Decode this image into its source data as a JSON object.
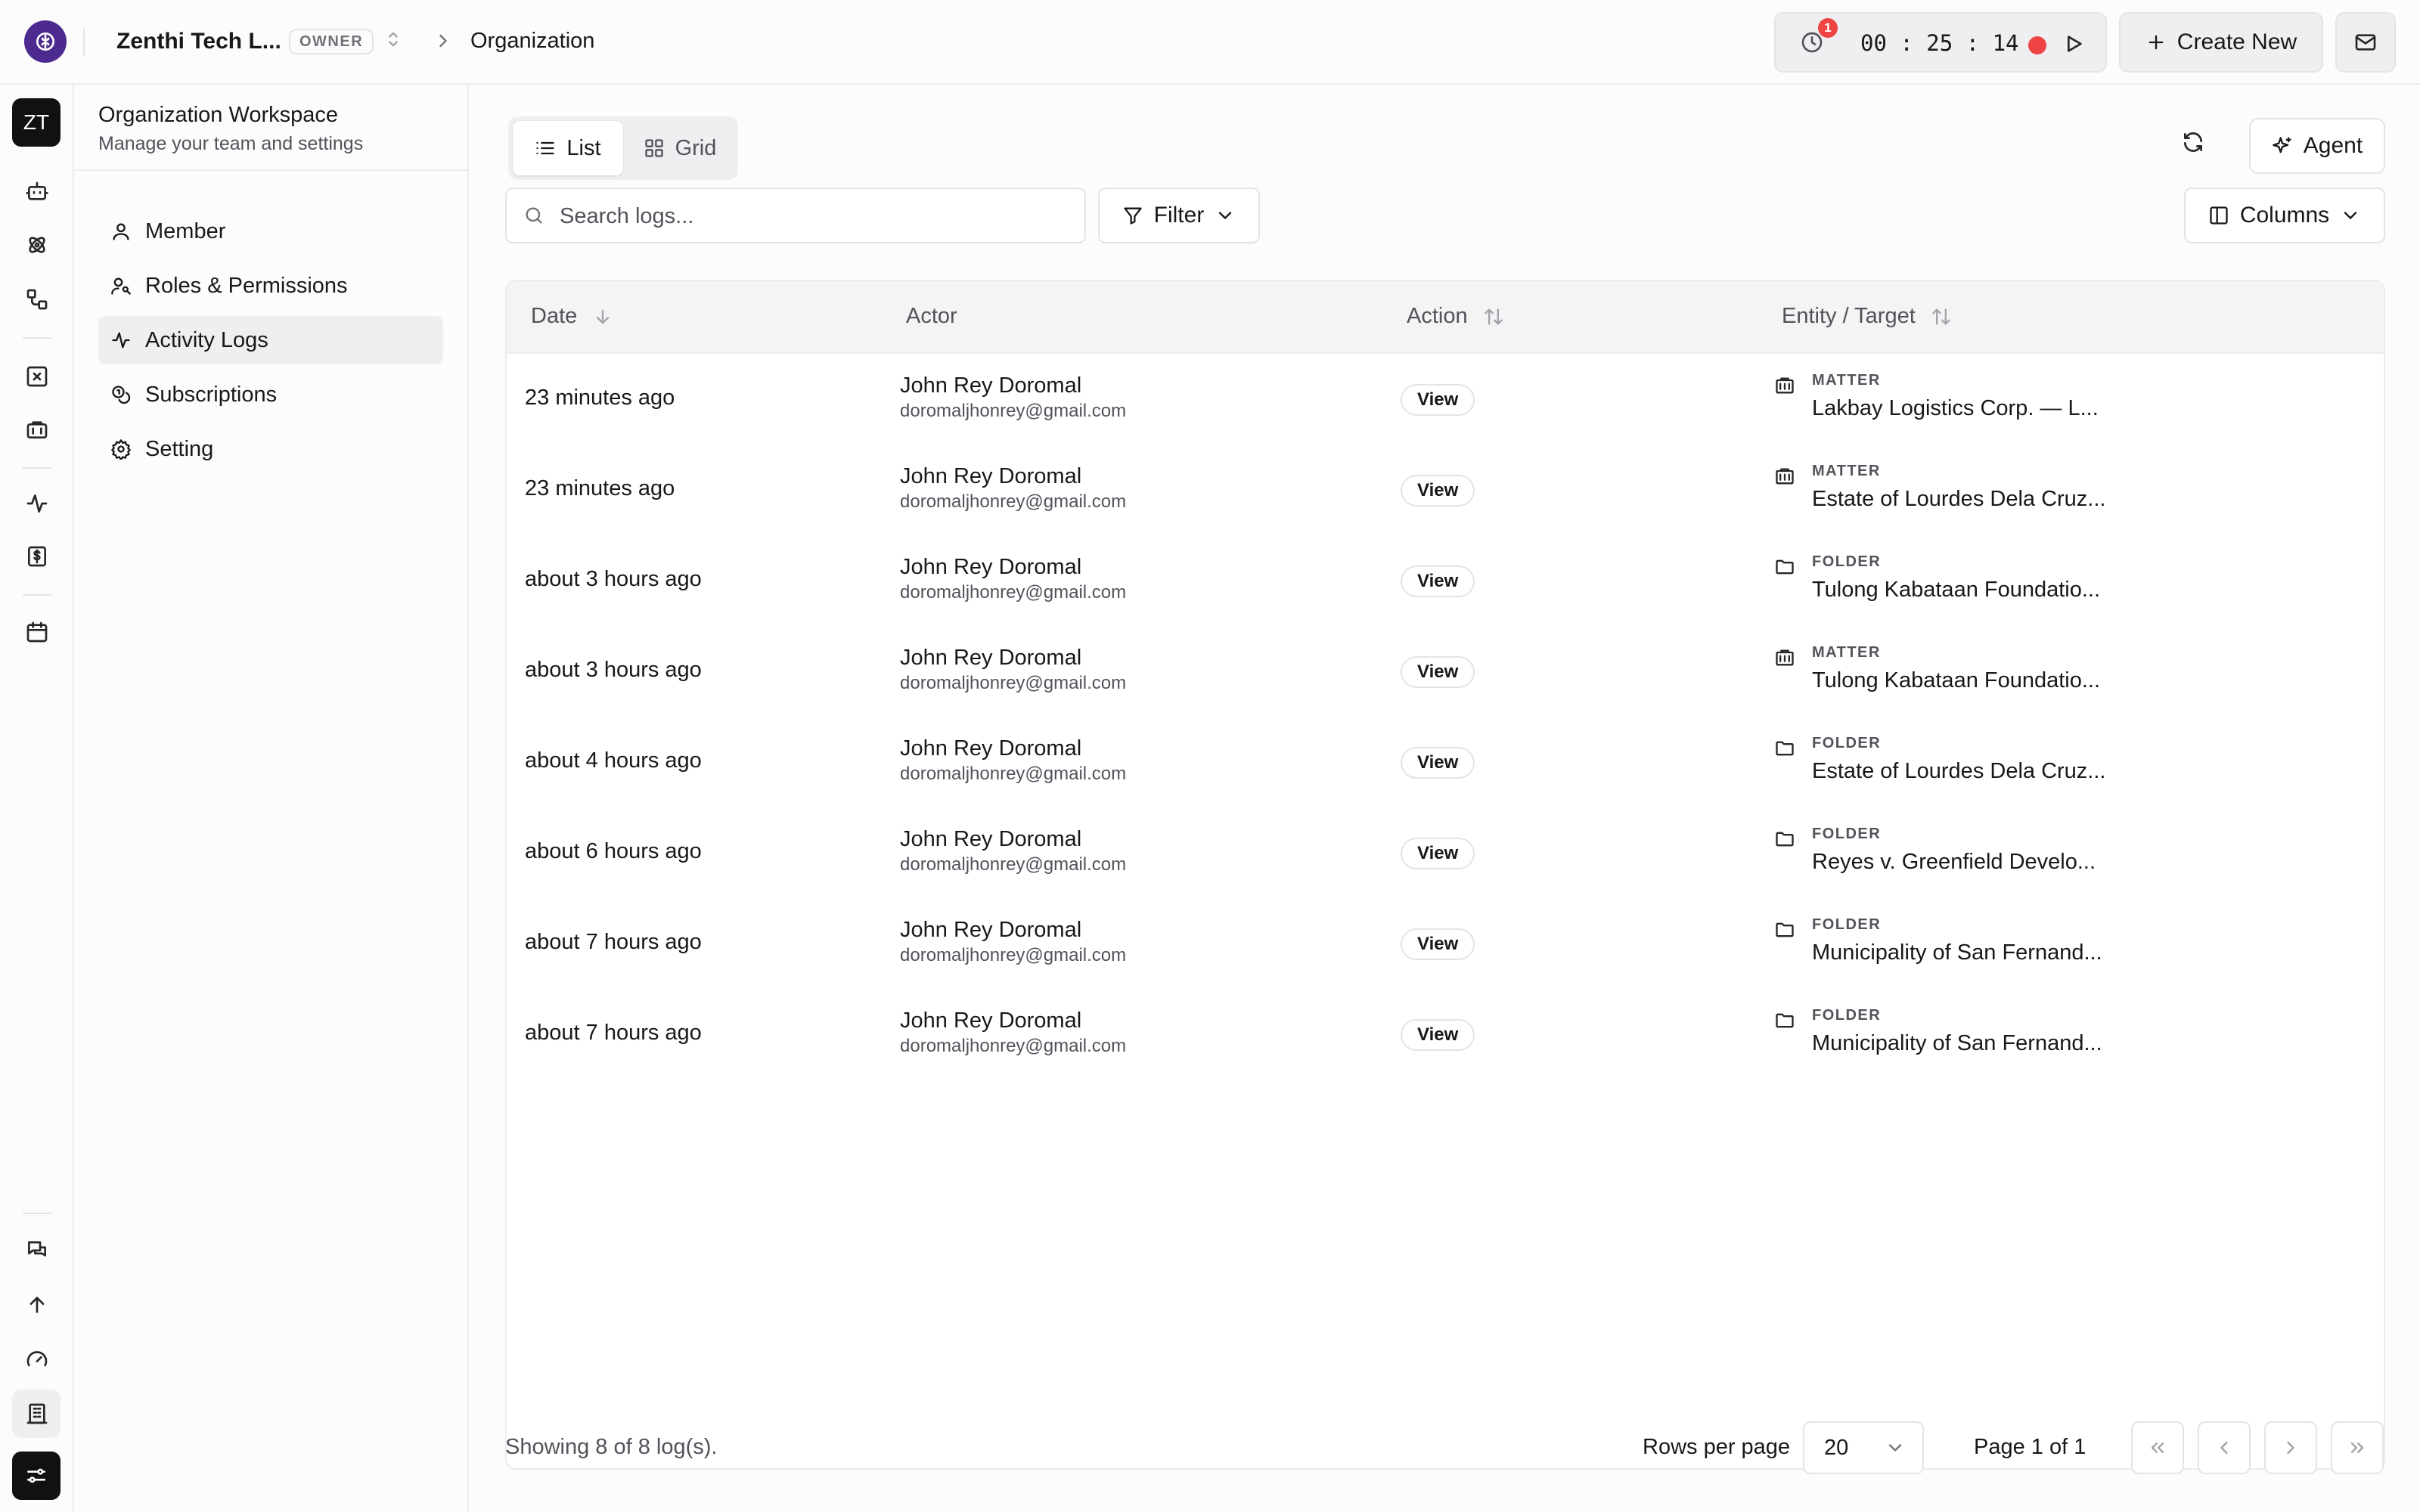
{
  "header": {
    "org_name": "Zenthi Tech L...",
    "org_role": "OWNER",
    "breadcrumb_current": "Organization",
    "timer": {
      "notifications": "1",
      "value": "00 : 25 : 14"
    },
    "create_new_label": "Create New"
  },
  "rail": {
    "avatar_initials": "ZT"
  },
  "sidebar": {
    "title": "Organization Workspace",
    "subtitle": "Manage your team and settings",
    "items": [
      {
        "label": "Member",
        "icon": "user-icon"
      },
      {
        "label": "Roles & Permissions",
        "icon": "user-key-icon"
      },
      {
        "label": "Activity Logs",
        "icon": "activity-icon",
        "active": true
      },
      {
        "label": "Subscriptions",
        "icon": "coins-icon"
      },
      {
        "label": "Setting",
        "icon": "gear-icon"
      }
    ]
  },
  "toolbar": {
    "view_list_label": "List",
    "view_grid_label": "Grid",
    "agent_label": "Agent",
    "search_placeholder": "Search logs...",
    "filter_label": "Filter",
    "columns_label": "Columns"
  },
  "table": {
    "headers": {
      "date": "Date",
      "actor": "Actor",
      "action": "Action",
      "entity": "Entity / Target"
    },
    "rows": [
      {
        "date": "23 minutes ago",
        "actor_name": "John Rey Doromal",
        "actor_email": "doromaljhonrey@gmail.com",
        "action": "View",
        "entity_type": "MATTER",
        "entity_name": "Lakbay Logistics Corp. — L..."
      },
      {
        "date": "23 minutes ago",
        "actor_name": "John Rey Doromal",
        "actor_email": "doromaljhonrey@gmail.com",
        "action": "View",
        "entity_type": "MATTER",
        "entity_name": "Estate of Lourdes Dela Cruz..."
      },
      {
        "date": "about 3 hours ago",
        "actor_name": "John Rey Doromal",
        "actor_email": "doromaljhonrey@gmail.com",
        "action": "View",
        "entity_type": "FOLDER",
        "entity_name": "Tulong Kabataan Foundatio..."
      },
      {
        "date": "about 3 hours ago",
        "actor_name": "John Rey Doromal",
        "actor_email": "doromaljhonrey@gmail.com",
        "action": "View",
        "entity_type": "MATTER",
        "entity_name": "Tulong Kabataan Foundatio..."
      },
      {
        "date": "about 4 hours ago",
        "actor_name": "John Rey Doromal",
        "actor_email": "doromaljhonrey@gmail.com",
        "action": "View",
        "entity_type": "FOLDER",
        "entity_name": "Estate of Lourdes Dela Cruz..."
      },
      {
        "date": "about 6 hours ago",
        "actor_name": "John Rey Doromal",
        "actor_email": "doromaljhonrey@gmail.com",
        "action": "View",
        "entity_type": "FOLDER",
        "entity_name": "Reyes v. Greenfield Develo..."
      },
      {
        "date": "about 7 hours ago",
        "actor_name": "John Rey Doromal",
        "actor_email": "doromaljhonrey@gmail.com",
        "action": "View",
        "entity_type": "FOLDER",
        "entity_name": "Municipality of San Fernand..."
      },
      {
        "date": "about 7 hours ago",
        "actor_name": "John Rey Doromal",
        "actor_email": "doromaljhonrey@gmail.com",
        "action": "View",
        "entity_type": "FOLDER",
        "entity_name": "Municipality of San Fernand..."
      }
    ]
  },
  "footer": {
    "showing": "Showing 8 of 8 log(s).",
    "rows_per_page_label": "Rows per page",
    "rows_per_page_value": "20",
    "page_info": "Page 1 of 1"
  },
  "colors": {
    "brand": "#4c2a8f",
    "recording": "#ef4444",
    "dark": "#111113"
  }
}
